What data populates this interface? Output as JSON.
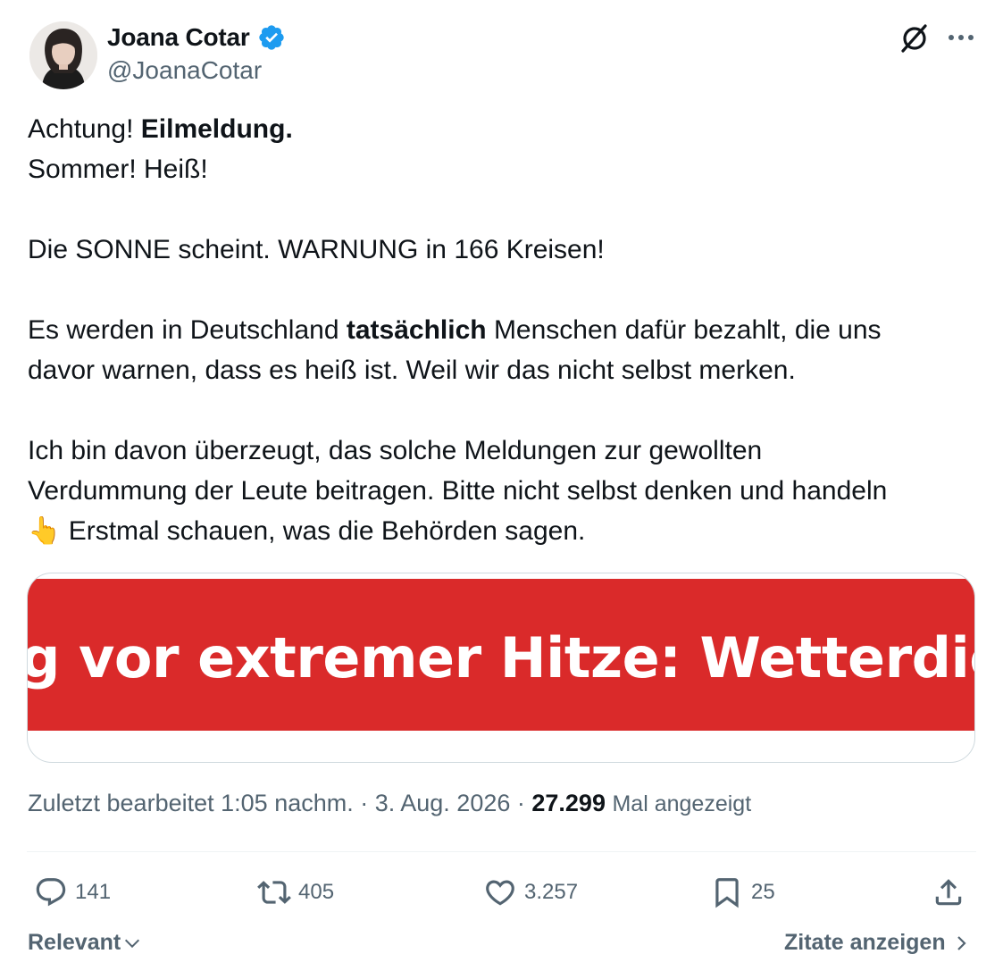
{
  "author": {
    "display_name": "Joana Cotar",
    "handle": "@JoanaCotar",
    "verified": true,
    "verified_color": "#1d9bf0"
  },
  "header": {
    "grok_icon": "grok-slash-circle-icon",
    "more_icon": "more-horizontal-icon"
  },
  "tweet": {
    "line1_plain": "Achtung! ",
    "line1_bold": "Eilmeldung.",
    "line2": "Sommer! Heiß!",
    "line3": "Die SONNE scheint. WARNUNG in 166 Kreisen!",
    "line4_before": "Es werden in Deutschland ",
    "line4_bold": "tatsächlich",
    "line4_after": " Menschen dafür bezahlt, die uns",
    "line5": "davor warnen, dass es heiß ist. Weil wir das nicht selbst merken.",
    "line6": "Ich bin davon überzeugt, das solche Meldungen zur gewollten",
    "line7": "Verdummung der Leute beitragen. Bitte nicht selbst denken und handeln",
    "line8_emoji": "👆",
    "line8_text": " Erstmal schauen, was die Behörden sagen."
  },
  "media": {
    "headline": "g vor extremer Hitze: Wetterdienst",
    "background_color": "#da2a2a"
  },
  "meta": {
    "edited_label": "Zuletzt bearbeitet",
    "time": "1:05 nachm.",
    "separator": " · ",
    "date": "3. Aug. 2026",
    "views_count": "27.299",
    "views_label": "Mal angezeigt"
  },
  "actions": {
    "replies": "141",
    "retweets": "405",
    "likes": "3.257",
    "bookmarks": "25"
  },
  "footer": {
    "sort_label": "Relevant",
    "quotes_label": "Zitate anzeigen"
  },
  "colors": {
    "text_primary": "#0f1419",
    "text_secondary": "#536471",
    "border": "#cfd9de",
    "accent_blue": "#1d9bf0"
  }
}
